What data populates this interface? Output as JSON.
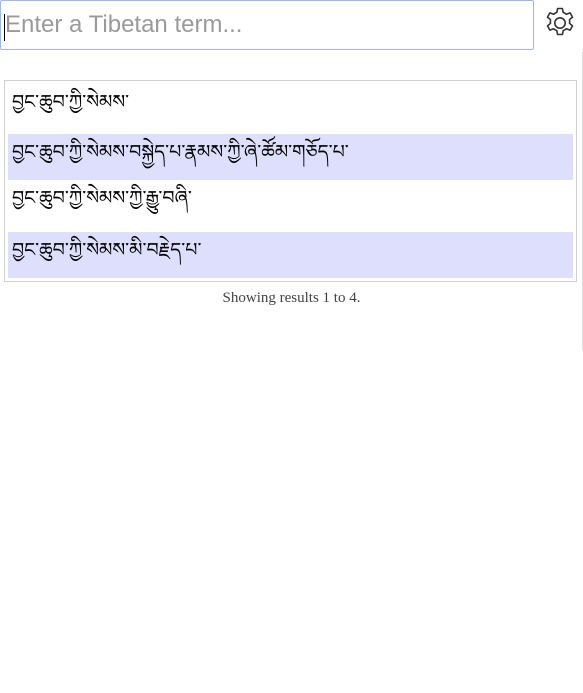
{
  "search": {
    "placeholder": "Enter a Tibetan term...",
    "value": ""
  },
  "settings": {
    "icon": "gear-icon"
  },
  "results": [
    {
      "term": "བྱང་ཆུབ་ཀྱི་སེམས་"
    },
    {
      "term": "བྱང་ཆུབ་ཀྱི་སེམས་བསྐྱེད་པ་རྣམས་ཀྱི་ཞེ་ཚོམ་གཅོད་པ་"
    },
    {
      "term": "བྱང་ཆུབ་ཀྱི་སེམས་ཀྱི་རྒྱུ་བཞི་"
    },
    {
      "term": "བྱང་ཆུབ་ཀྱི་སེམས་མི་བརྗེད་པ་"
    }
  ],
  "status_text": "Showing results 1 to 4.",
  "colors": {
    "row_highlight": "#dedefd",
    "input_border": "#9fb6e6",
    "box_border": "#cfcfcf"
  }
}
